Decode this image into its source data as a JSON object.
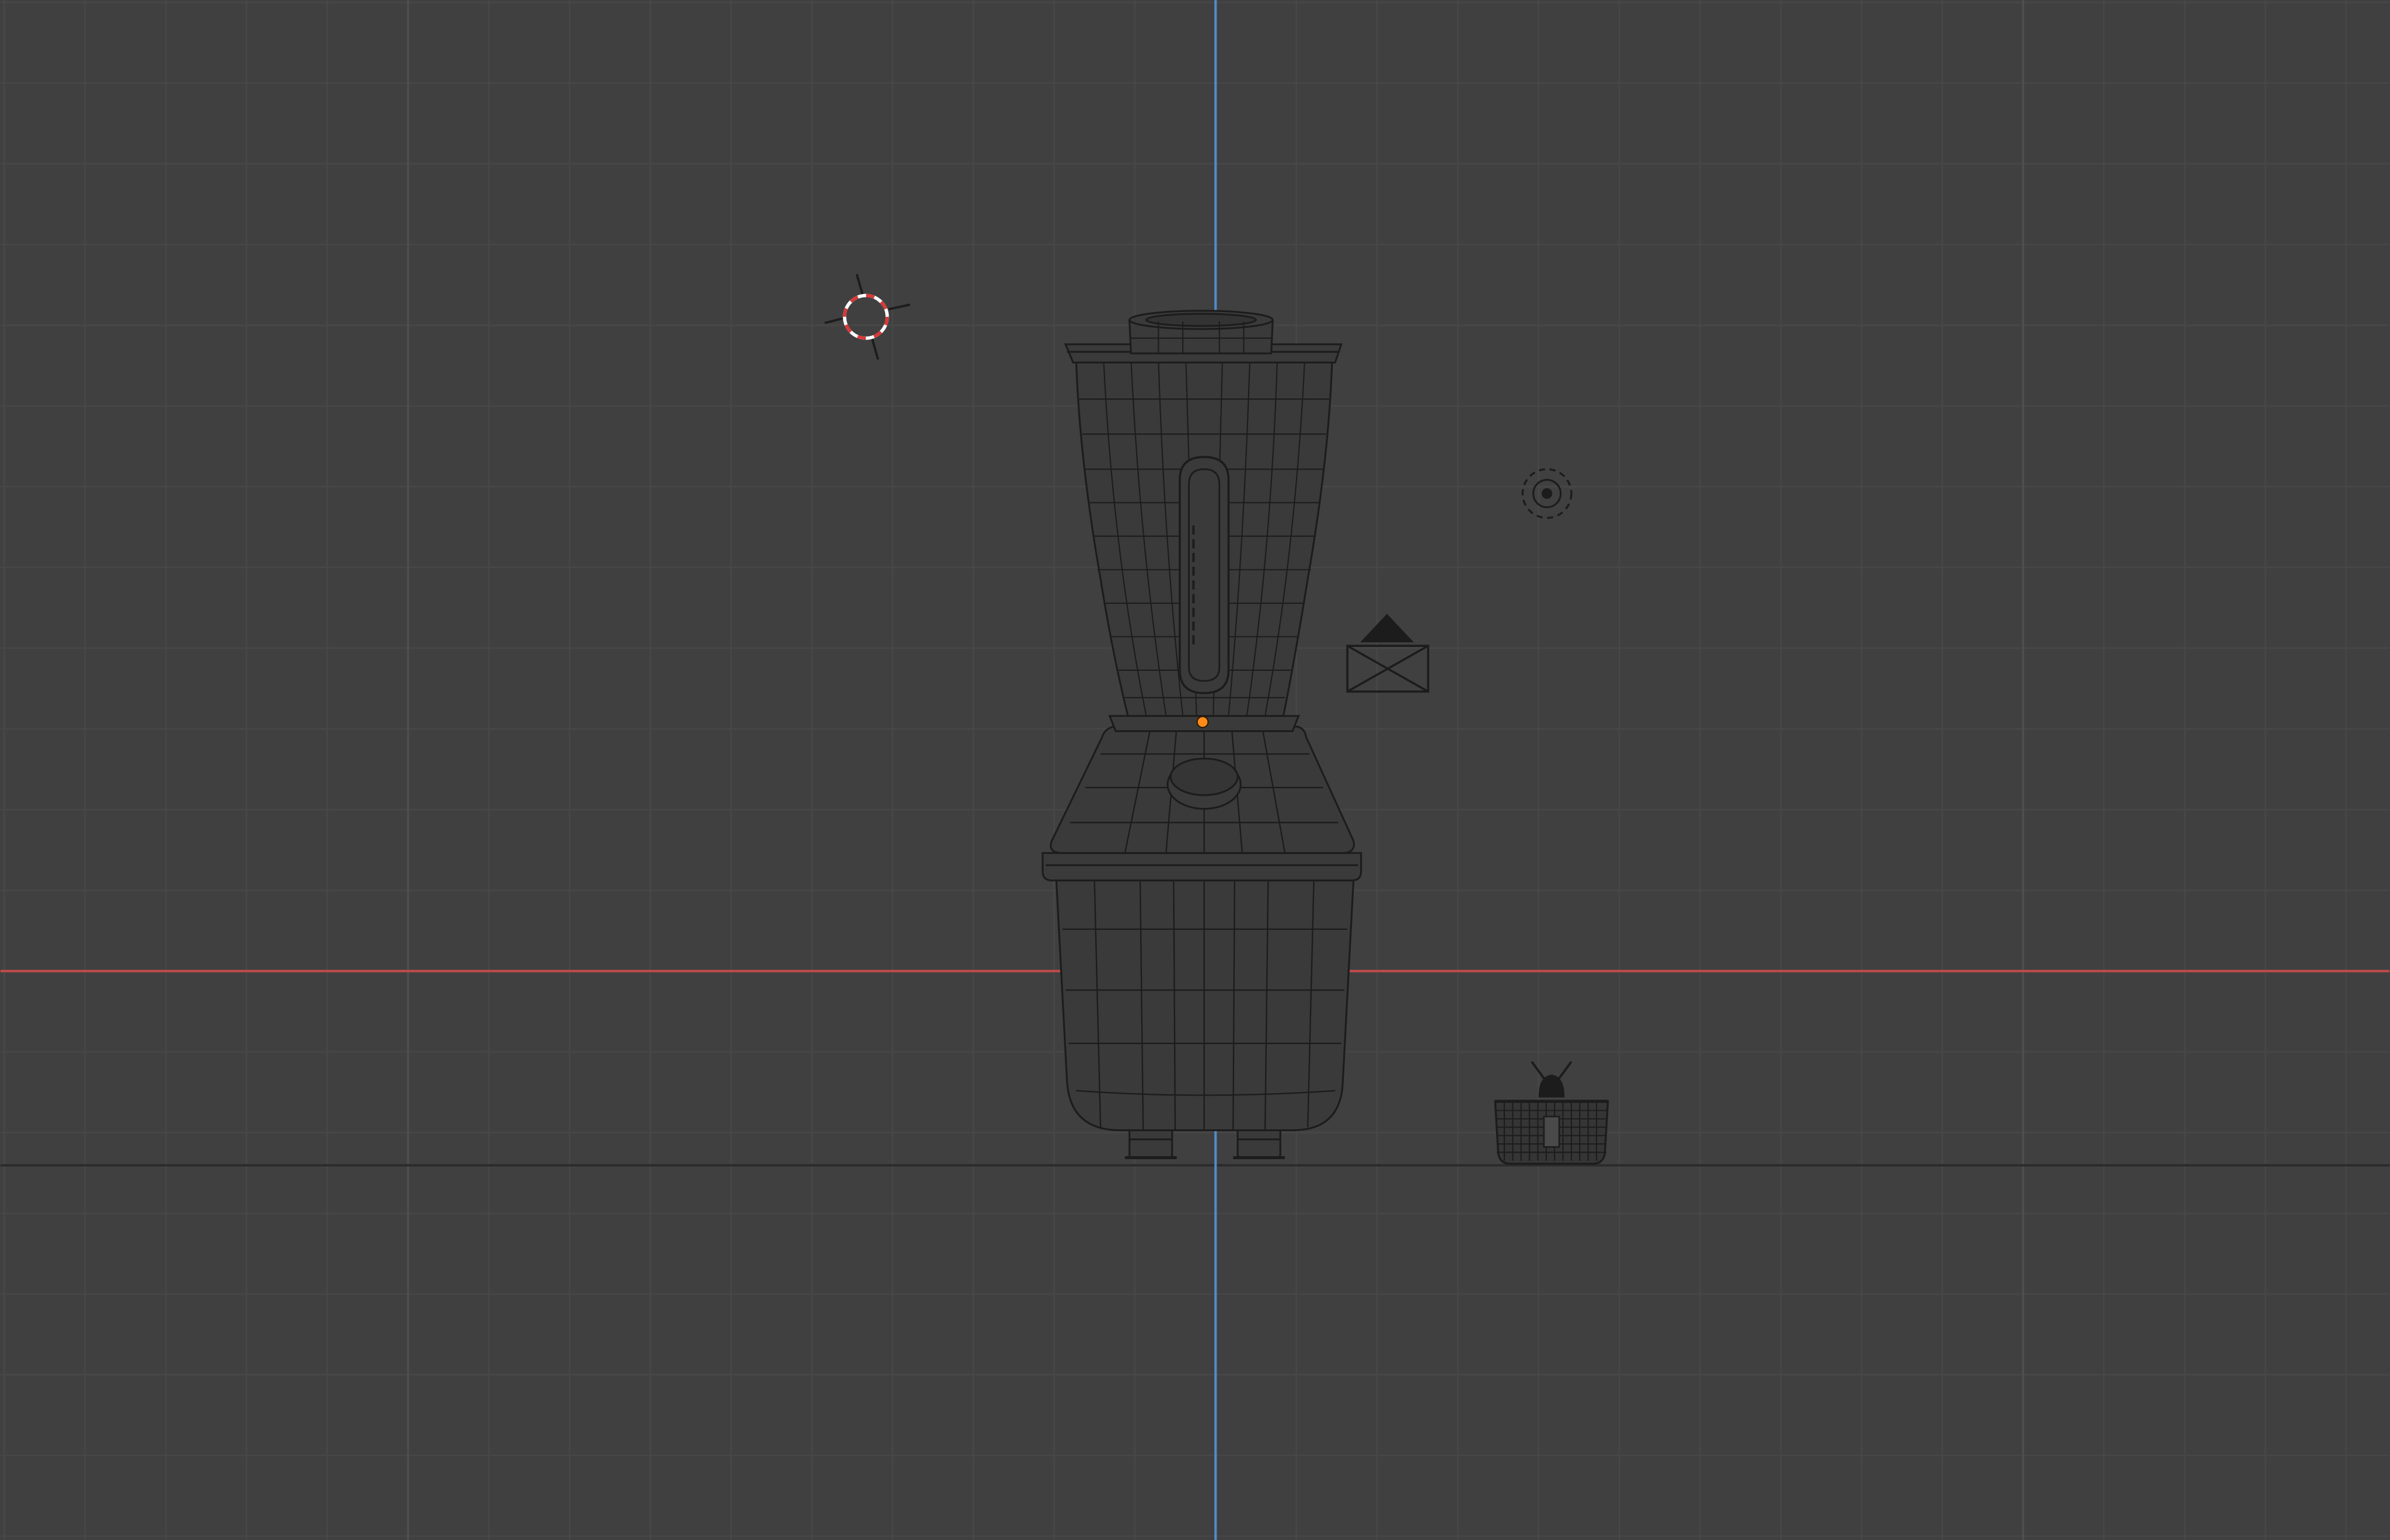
{
  "viewport": {
    "background": "#404040",
    "grid_minor_color": "#474747",
    "grid_major_color": "#4f4f4f",
    "x_axis_color": "#c24a4a",
    "z_axis_color": "#4f8dc9",
    "ground_line_color": "#2b2b2b",
    "wire_color": "#1c1c1c"
  },
  "objects": [
    {
      "name": "blender-mesh",
      "icon": "blender-wireframe-icon"
    },
    {
      "name": "3d-cursor",
      "icon": "3d-cursor-icon",
      "colors": [
        "#d63a3a",
        "#ffffff"
      ]
    },
    {
      "name": "light",
      "icon": "point-light-icon"
    },
    {
      "name": "camera",
      "icon": "camera-icon"
    },
    {
      "name": "basket-mesh",
      "icon": "basket-wireframe-icon"
    }
  ],
  "selection": {
    "origin_color": "#ff8c1a"
  }
}
